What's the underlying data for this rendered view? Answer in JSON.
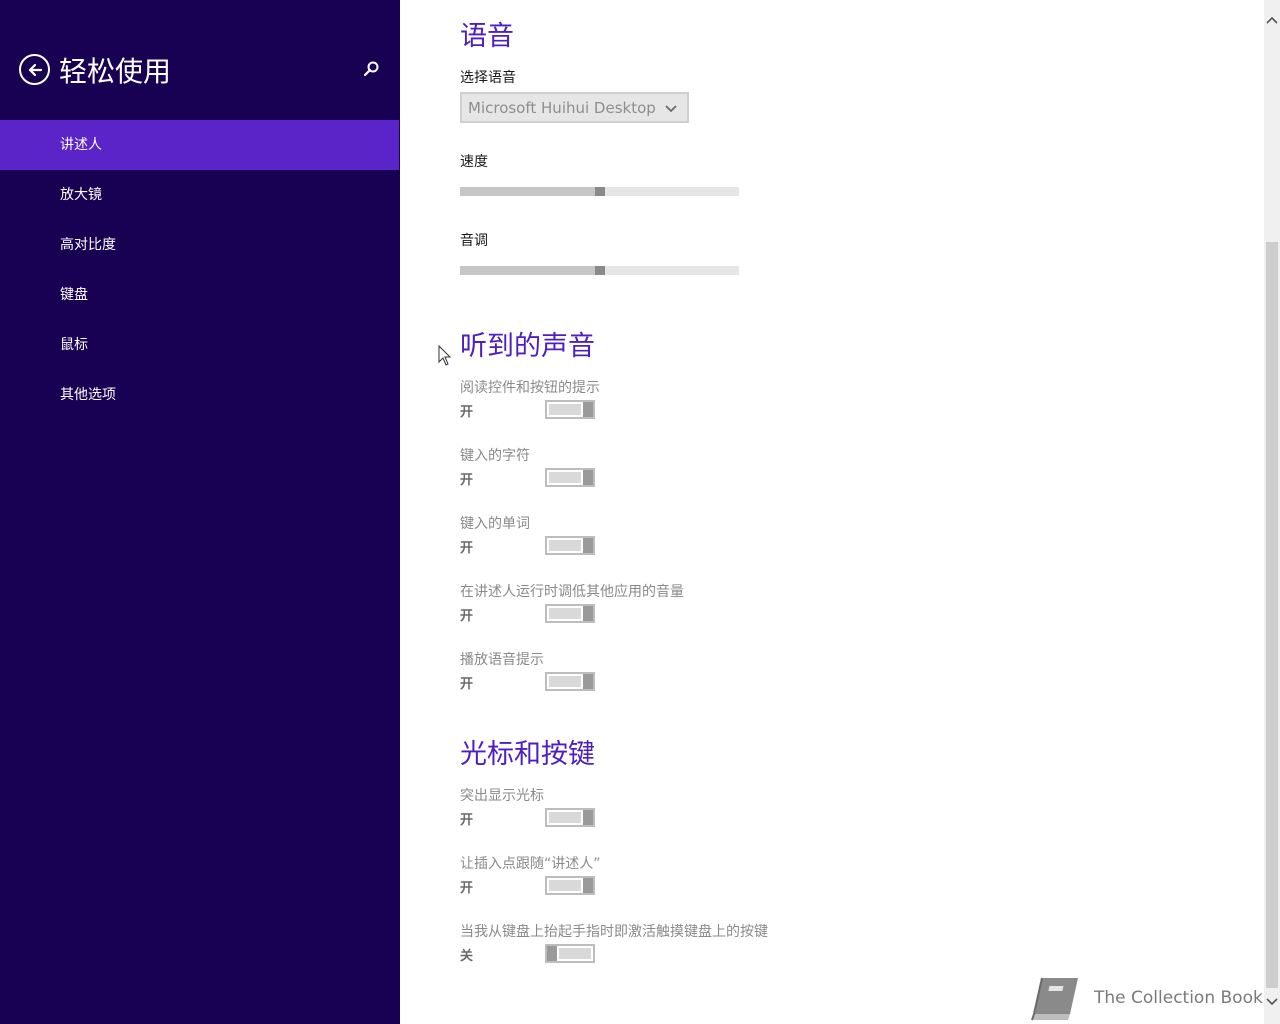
{
  "sidebar": {
    "title": "轻松使用",
    "back_icon": "back-arrow-icon",
    "search_icon": "search-icon",
    "items": [
      {
        "label": "讲述人",
        "active": true
      },
      {
        "label": "放大镜",
        "active": false
      },
      {
        "label": "高对比度",
        "active": false
      },
      {
        "label": "键盘",
        "active": false
      },
      {
        "label": "鼠标",
        "active": false
      },
      {
        "label": "其他选项",
        "active": false
      }
    ]
  },
  "main": {
    "voice": {
      "title": "语音",
      "select_label": "选择语音",
      "select_value": "Microsoft Huihui Desktop",
      "speed_label": "速度",
      "speed_level": 0.5,
      "pitch_label": "音调",
      "pitch_level": 0.5
    },
    "sounds": {
      "title": "听到的声音",
      "items": [
        {
          "label": "阅读控件和按钮的提示",
          "state": "开"
        },
        {
          "label": "键入的字符",
          "state": "开"
        },
        {
          "label": "键入的单词",
          "state": "开"
        },
        {
          "label": "在讲述人运行时调低其他应用的音量",
          "state": "开"
        },
        {
          "label": "播放语音提示",
          "state": "开"
        }
      ]
    },
    "cursor_keys": {
      "title": "光标和按键",
      "items": [
        {
          "label": "突出显示光标",
          "state": "开"
        },
        {
          "label": "让插入点跟随“讲述人”",
          "state": "开"
        },
        {
          "label": "当我从键盘上抬起手指时即激活触摸键盘上的按键",
          "state": "关"
        }
      ]
    }
  },
  "watermark": {
    "text": "The Collection Book",
    "icon": "book-icon"
  },
  "colors": {
    "sidebar_bg": "#180052",
    "sidebar_active": "#5a24c8",
    "accent": "#4e1fc0"
  }
}
